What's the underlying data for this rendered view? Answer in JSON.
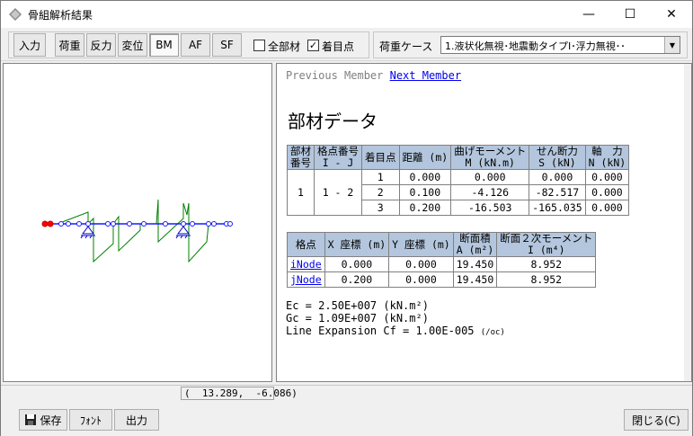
{
  "window": {
    "title": "骨組解析結果",
    "minimize_glyph": "—",
    "maximize_glyph": "☐",
    "close_glyph": "✕"
  },
  "toolbar": {
    "input_label": "入力",
    "load_label": "荷重",
    "reaction_label": "反力",
    "displacement_label": "変位",
    "bm_label": "BM",
    "af_label": "AF",
    "sf_label": "SF",
    "all_members_label": "全部材",
    "all_members_checked": false,
    "focus_point_label": "着目点",
    "focus_point_checked": true,
    "load_case_label": "荷重ケース",
    "load_case_value": "1.液状化無視･地震動タイプⅠ･浮力無視･･"
  },
  "member_view": {
    "prev_label": "Previous Member",
    "next_label": "Next Member",
    "heading": "部材データ",
    "table1": {
      "headers": [
        "部材\n番号",
        "格点番号\nI - J",
        "着目点",
        "距離 (m)",
        "曲げモーメント\nM (kN.m)",
        "せん断力\nS (kN)",
        "軸　力\nN (kN)"
      ],
      "member_no": "1",
      "node_ij": "1 - 2",
      "rows": [
        [
          "1",
          "0.000",
          "0.000",
          "0.000",
          "0.000"
        ],
        [
          "2",
          "0.100",
          "-4.126",
          "-82.517",
          "0.000"
        ],
        [
          "3",
          "0.200",
          "-16.503",
          "-165.035",
          "0.000"
        ]
      ]
    },
    "table2": {
      "headers": [
        "格点",
        "X 座標 (m)",
        "Y 座標 (m)",
        "断面積\nA (m²)",
        "断面２次モーメント\nI (m⁴)"
      ],
      "rows": [
        [
          "iNode",
          "0.000",
          "0.000",
          "19.450",
          "8.952"
        ],
        [
          "jNode",
          "0.200",
          "0.000",
          "19.450",
          "8.952"
        ]
      ]
    },
    "ec_text": "Ec = 2.50E+007 (kN.m²)",
    "gc_text": "Gc = 1.09E+007 (kN.m²)",
    "line_exp_text": "Line Expansion Cf = 1.00E-005",
    "line_exp_unit": "(/oc)"
  },
  "status": {
    "coord_text": "(  13.289,  -6.086)"
  },
  "bottom": {
    "save_label": "保存",
    "font_label": "ﾌｫﾝﾄ",
    "output_label": "出力",
    "close_label": "閉じる(C)"
  },
  "colors": {
    "frame_line": "#1a1aff",
    "moment_line": "#008000",
    "support": "#0000cc",
    "node_focus": "#ff0000",
    "table_header": "#b3c6dd"
  }
}
